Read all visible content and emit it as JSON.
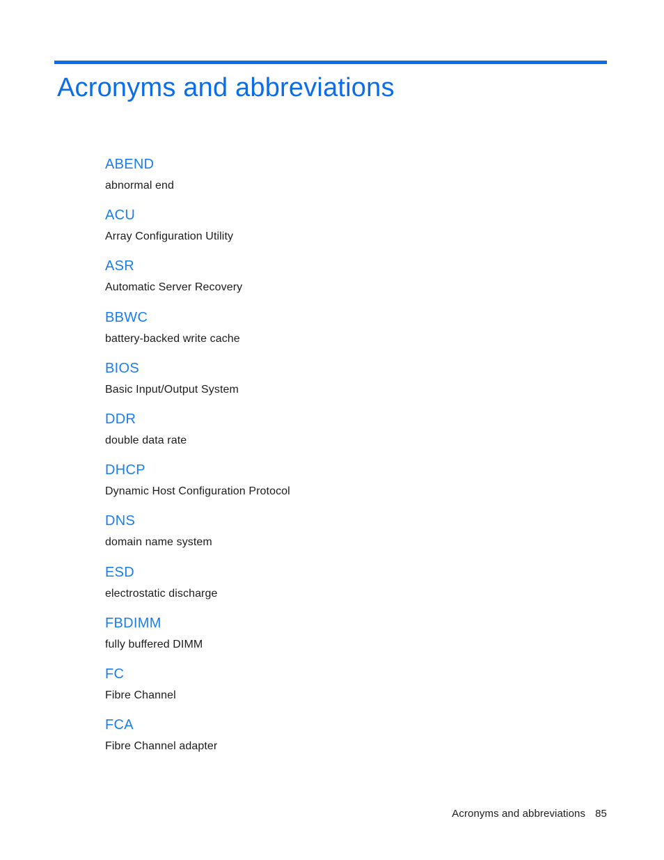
{
  "document": {
    "title": "Acronyms and abbreviations",
    "accent_color": "#0b6de8",
    "term_color": "#1a7df0",
    "body_color": "#1c1c1c",
    "background_color": "#ffffff"
  },
  "glossary": {
    "entries": [
      {
        "term": "ABEND",
        "definition": "abnormal end"
      },
      {
        "term": "ACU",
        "definition": "Array Configuration Utility"
      },
      {
        "term": "ASR",
        "definition": "Automatic Server Recovery"
      },
      {
        "term": "BBWC",
        "definition": "battery-backed write cache"
      },
      {
        "term": "BIOS",
        "definition": "Basic Input/Output System"
      },
      {
        "term": "DDR",
        "definition": "double data rate"
      },
      {
        "term": "DHCP",
        "definition": "Dynamic Host Configuration Protocol"
      },
      {
        "term": "DNS",
        "definition": "domain name system"
      },
      {
        "term": "ESD",
        "definition": "electrostatic discharge"
      },
      {
        "term": "FBDIMM",
        "definition": "fully buffered DIMM"
      },
      {
        "term": "FC",
        "definition": "Fibre Channel"
      },
      {
        "term": "FCA",
        "definition": "Fibre Channel adapter"
      }
    ]
  },
  "footer": {
    "label": "Acronyms and abbreviations",
    "page_number": "85"
  }
}
